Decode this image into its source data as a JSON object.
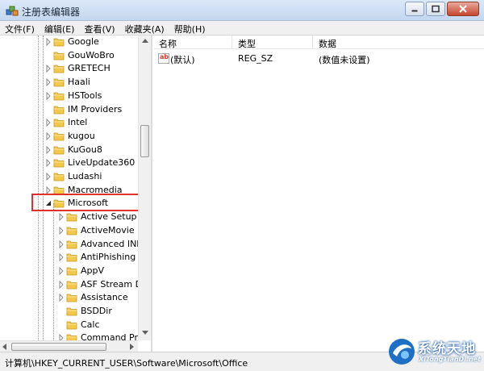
{
  "window": {
    "title": "注册表编辑器"
  },
  "menu": [
    {
      "label": "文件(F)"
    },
    {
      "label": "编辑(E)"
    },
    {
      "label": "查看(V)"
    },
    {
      "label": "收藏夹(A)"
    },
    {
      "label": "帮助(H)"
    }
  ],
  "tree": {
    "items": [
      {
        "label": "Google",
        "expandable": true,
        "level": 1
      },
      {
        "label": "GouWoBro",
        "expandable": false,
        "level": 1
      },
      {
        "label": "GRETECH",
        "expandable": true,
        "level": 1
      },
      {
        "label": "Haali",
        "expandable": true,
        "level": 1
      },
      {
        "label": "HSTools",
        "expandable": true,
        "level": 1
      },
      {
        "label": "IM Providers",
        "expandable": false,
        "level": 1
      },
      {
        "label": "Intel",
        "expandable": true,
        "level": 1
      },
      {
        "label": "kugou",
        "expandable": true,
        "level": 1
      },
      {
        "label": "KuGou8",
        "expandable": true,
        "level": 1
      },
      {
        "label": "LiveUpdate360",
        "expandable": true,
        "level": 1
      },
      {
        "label": "Ludashi",
        "expandable": true,
        "level": 1
      },
      {
        "label": "Macromedia",
        "expandable": true,
        "level": 1
      },
      {
        "label": "Microsoft",
        "expandable": true,
        "expanded": true,
        "level": 1
      },
      {
        "label": "Active Setup",
        "expandable": true,
        "level": 2
      },
      {
        "label": "ActiveMovie",
        "expandable": true,
        "level": 2
      },
      {
        "label": "Advanced INF",
        "expandable": true,
        "level": 2
      },
      {
        "label": "AntiPhishing",
        "expandable": true,
        "level": 2
      },
      {
        "label": "AppV",
        "expandable": true,
        "level": 2
      },
      {
        "label": "ASF Stream De",
        "expandable": true,
        "level": 2
      },
      {
        "label": "Assistance",
        "expandable": true,
        "level": 2
      },
      {
        "label": "BSDDir",
        "expandable": false,
        "level": 2
      },
      {
        "label": "Calc",
        "expandable": false,
        "level": 2
      },
      {
        "label": "Command Pro",
        "expandable": true,
        "level": 2
      }
    ]
  },
  "list": {
    "columns": [
      "名称",
      "类型",
      "数据"
    ],
    "rows": [
      {
        "name": "(默认)",
        "type": "REG_SZ",
        "data": "(数值未设置)",
        "icon": "ab"
      }
    ]
  },
  "status": {
    "path": "计算机\\HKEY_CURRENT_USER\\Software\\Microsoft\\Office"
  },
  "watermark": {
    "title": "系统天地",
    "subtitle": "XiTongTianDi.net"
  },
  "colors": {
    "highlight": "#e0302b",
    "folder": "#f2c94c",
    "titlebar": "#c4d7ef"
  }
}
